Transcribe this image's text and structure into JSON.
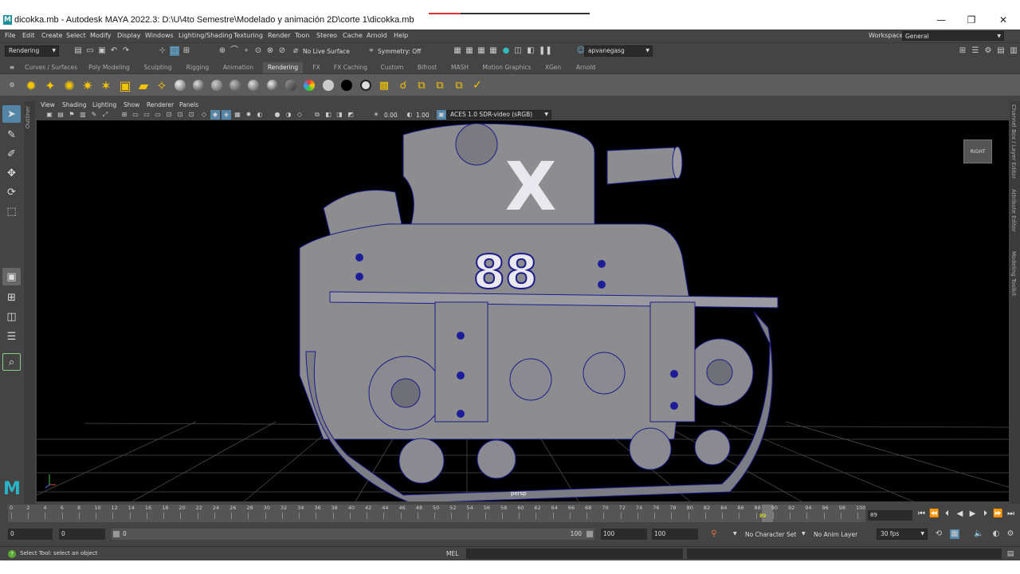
{
  "window": {
    "title": "dicokka.mb - Autodesk MAYA 2022.3: D:\\U\\4to Semestre\\Modelado y animación 2D\\corte 1\\dicokka.mb",
    "app_icon": "M",
    "minimize": "—",
    "maximize": "❐",
    "close": "✕"
  },
  "menu": [
    "File",
    "Edit",
    "Create",
    "Select",
    "Modify",
    "Display",
    "Windows",
    "Lighting/Shading",
    "Texturing",
    "Render",
    "Toon",
    "Stereo",
    "Cache",
    "Arnold",
    "Help"
  ],
  "workspace": {
    "label": "Workspace:",
    "value": "General"
  },
  "status": {
    "menuset": "Rendering",
    "live_surface": "No Live Surface",
    "symmetry": "Symmetry: Off",
    "user": "apvanegasg"
  },
  "shelf": {
    "tabs": [
      "Curves / Surfaces",
      "Poly Modeling",
      "Sculpting",
      "Rigging",
      "Animation",
      "Rendering",
      "FX",
      "FX Caching",
      "Custom",
      "Bifrost",
      "MASH",
      "Motion Graphics",
      "XGen",
      "Arnold"
    ],
    "active_tab": "Rendering"
  },
  "panel": {
    "menus": [
      "View",
      "Shading",
      "Lighting",
      "Show",
      "Renderer",
      "Panels"
    ],
    "exposure": "0.00",
    "gamma": "1.00",
    "color_space": "ACES 1.0 SDR-video (sRGB)",
    "camera": "persp",
    "viewcube_label": "RIGHT",
    "model_letter": "X",
    "model_number": "88"
  },
  "side_panels": {
    "outliner": "Outliner",
    "right": [
      "Channel Box / Layer Editor",
      "Attribute Editor",
      "Modeling Toolkit"
    ]
  },
  "timeline": {
    "ticks": [
      "0",
      "2",
      "4",
      "6",
      "8",
      "10",
      "12",
      "14",
      "16",
      "18",
      "20",
      "22",
      "24",
      "26",
      "28",
      "30",
      "32",
      "34",
      "36",
      "38",
      "40",
      "42",
      "44",
      "46",
      "48",
      "50",
      "52",
      "54",
      "56",
      "58",
      "60",
      "62",
      "64",
      "66",
      "68",
      "70",
      "72",
      "74",
      "76",
      "78",
      "80",
      "82",
      "84",
      "86",
      "88",
      "90",
      "92",
      "94",
      "96",
      "98",
      "100"
    ],
    "current_frame": "89",
    "current_frame_field": "89"
  },
  "range": {
    "start": "0",
    "anim_start": "0",
    "range_start_label": "0",
    "range_end_label": "100",
    "playback_end": "100",
    "anim_end": "100",
    "character_set": "No Character Set",
    "anim_layer": "No Anim Layer",
    "fps": "30 fps"
  },
  "help": {
    "text": "Select Tool: select an object",
    "mel_label": "MEL"
  },
  "colors": {
    "mesh_fill": "#8d8d90",
    "wire": "#1c1c8c",
    "accent_blue": "#5285a6",
    "shelf_yellow": "#f5c400"
  }
}
